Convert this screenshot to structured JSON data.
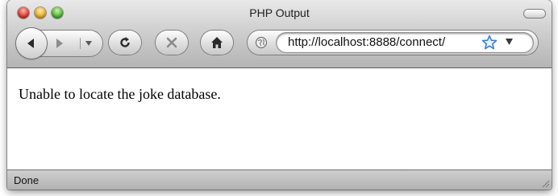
{
  "window": {
    "title": "PHP Output"
  },
  "toolbar": {
    "address": "http://localhost:8888/connect/"
  },
  "icons": {
    "back": "back-arrow-icon",
    "forward": "forward-arrow-icon",
    "history_menu": "chevron-down-icon",
    "reload": "reload-icon",
    "stop": "stop-icon",
    "home": "home-icon",
    "site": "globe-icon",
    "bookmark": "star-icon",
    "address_menu": "chevron-down-icon"
  },
  "page": {
    "message": "Unable to locate the joke database."
  },
  "status": {
    "text": "Done"
  },
  "colors": {
    "close": "#e0443a",
    "minimize": "#f1b233",
    "zoom": "#58bd3f",
    "star": "#3a7fd6"
  }
}
